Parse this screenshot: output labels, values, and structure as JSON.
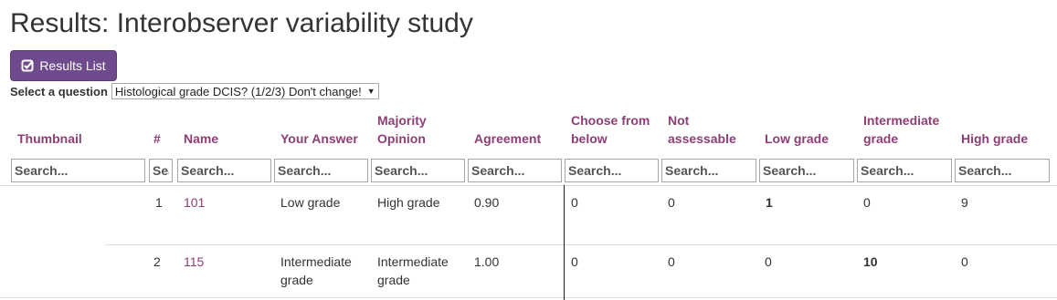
{
  "page": {
    "title": "Results: Interobserver variability study"
  },
  "results_button": {
    "label": "Results List",
    "icon": "check-square-icon"
  },
  "question": {
    "label": "Select a question",
    "selected": "Histological grade DCIS? (1/2/3) Don't change!"
  },
  "table": {
    "headers": [
      "Thumbnail",
      "#",
      "Name",
      "Your Answer",
      "Majority Opinion",
      "Agreement",
      "Choose from below",
      "Not assessable",
      "Low grade",
      "Intermediate grade",
      "High grade"
    ],
    "search_placeholders": [
      "Search...",
      "Sea",
      "Search...",
      "Search...",
      "Search...",
      "Search...",
      "Search...",
      "Search...",
      "Search...",
      "Search...",
      "Search..."
    ],
    "rows": [
      {
        "num": "1",
        "name": "101",
        "your_answer": "Low grade",
        "majority": "High grade",
        "agreement": "0.90",
        "choose_from_below": "0",
        "not_assessable": "0",
        "low_grade": "1",
        "intermediate_grade": "0",
        "high_grade": "9"
      },
      {
        "num": "2",
        "name": "115",
        "your_answer": "Intermediate grade",
        "majority": "Intermediate grade",
        "agreement": "1.00",
        "choose_from_below": "0",
        "not_assessable": "0",
        "low_grade": "0",
        "intermediate_grade": "10",
        "high_grade": "0"
      }
    ]
  },
  "colors": {
    "accent": "#8e3e76",
    "button": "#6f4b8e"
  }
}
